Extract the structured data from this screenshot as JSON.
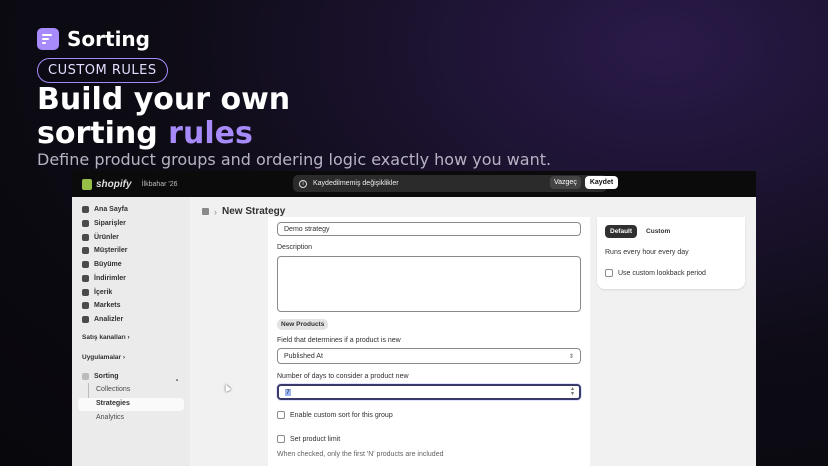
{
  "hero": {
    "brand_name": "Sorting",
    "tag": "CUSTOM RULES",
    "headline_line1": "Build your own",
    "headline_line2_plain": "sorting ",
    "headline_line2_accent": "rules",
    "subline": "Define product groups and ordering logic exactly how you want."
  },
  "topbar": {
    "logo": "shopify",
    "season": "İlkbahar '26",
    "unsaved_text": "Kaydedilmemiş değişiklikler",
    "discard_label": "Vazgeç",
    "save_label": "Kaydet"
  },
  "sidebar": {
    "items": [
      {
        "label": "Ana Sayfa"
      },
      {
        "label": "Siparişler"
      },
      {
        "label": "Ürünler"
      },
      {
        "label": "Müşteriler"
      },
      {
        "label": "Büyüme"
      },
      {
        "label": "İndirimler"
      },
      {
        "label": "İçerik"
      },
      {
        "label": "Markets"
      },
      {
        "label": "Analizler"
      }
    ],
    "sales_channels": "Satış kanalları",
    "apps": "Uygulamalar",
    "app_name": "Sorting",
    "app_sub": [
      {
        "label": "Collections"
      },
      {
        "label": "Strategies"
      },
      {
        "label": "Analytics"
      }
    ]
  },
  "page": {
    "title": "New Strategy"
  },
  "form": {
    "name_value": "Demo strategy",
    "description_label": "Description",
    "section_badge": "New Products",
    "field_label": "Field that determines if a product is new",
    "field_value": "Published At",
    "days_label": "Number of days to consider a product new",
    "days_value": "7",
    "enable_custom_sort": "Enable custom sort for this group",
    "set_limit": "Set product limit",
    "limit_help": "When checked, only the first 'N' products are included"
  },
  "side_card": {
    "tab_default": "Default",
    "tab_custom": "Custom",
    "schedule": "Runs every hour every day",
    "lookback": "Use custom lookback period"
  },
  "colors": {
    "accent": "#a78bfa",
    "shopify_green": "#95bf47"
  }
}
